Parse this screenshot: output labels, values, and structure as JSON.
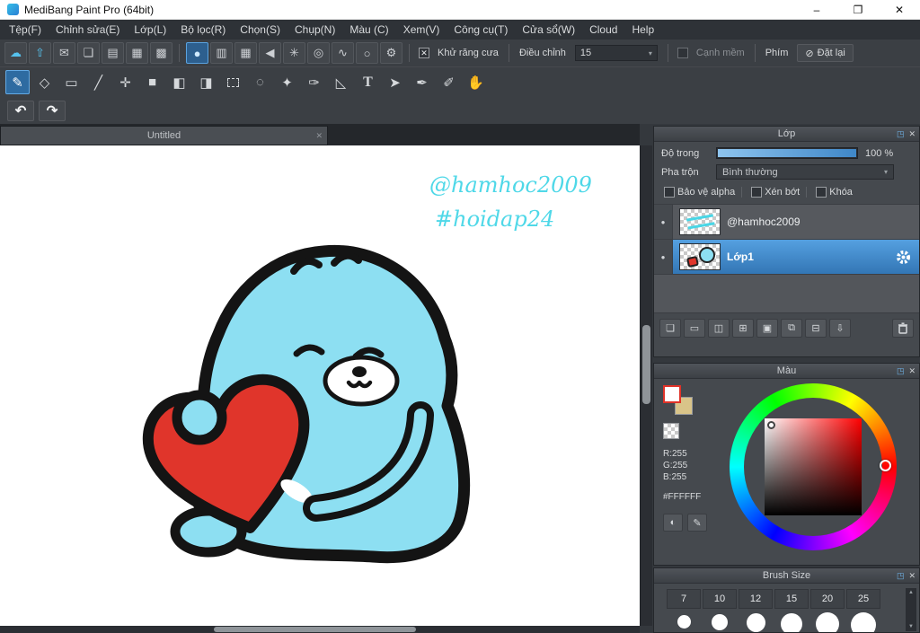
{
  "window": {
    "title": "MediBang Paint Pro (64bit)",
    "minimize": "–",
    "maximize": "❐",
    "close": "✕"
  },
  "menu": {
    "items": [
      "Tệp(F)",
      "Chỉnh sửa(E)",
      "Lớp(L)",
      "Bộ lọc(R)",
      "Chọn(S)",
      "Chụp(N)",
      "Màu (C)",
      "Xem(V)",
      "Công cụ(T)",
      "Cửa sổ(W)",
      "Cloud",
      "Help"
    ]
  },
  "toolbar1": {
    "file_icons": [
      {
        "name": "cloud-brush",
        "glyph": "☁"
      },
      {
        "name": "publish",
        "glyph": "⇧"
      },
      {
        "name": "comment",
        "glyph": "✉"
      },
      {
        "name": "chat",
        "glyph": "❏"
      },
      {
        "name": "document",
        "glyph": "▤"
      },
      {
        "name": "material-grid",
        "glyph": "▦"
      },
      {
        "name": "palette-cells",
        "glyph": "▩"
      }
    ],
    "brush_type_icons": [
      {
        "name": "brush-circle",
        "glyph": "●"
      },
      {
        "name": "brush-gradient",
        "glyph": "▥"
      },
      {
        "name": "brush-grid",
        "glyph": "▦"
      },
      {
        "name": "brush-triangle",
        "glyph": "◀"
      },
      {
        "name": "brush-scatter",
        "glyph": "✳"
      },
      {
        "name": "brush-concentric",
        "glyph": "◎"
      },
      {
        "name": "brush-curve",
        "glyph": "∿"
      },
      {
        "name": "brush-ring",
        "glyph": "○"
      },
      {
        "name": "brush-settings",
        "glyph": "⚙"
      }
    ],
    "antialias_label": "Khử răng cưa",
    "antialias_check": "✕",
    "adjust_label": "Điều chỉnh",
    "adjust_value": "15",
    "caret": "▾",
    "soft_edge_label": "Cạnh mềm",
    "key_label": "Phím",
    "reset_icon": "⊘",
    "reset_label": "Đặt lại"
  },
  "toolbar2": {
    "tools": [
      {
        "name": "brush-tool",
        "glyph": "✎",
        "selected": true
      },
      {
        "name": "eraser-tool",
        "glyph": "◇"
      },
      {
        "name": "shape-brush-tool",
        "glyph": "▭"
      },
      {
        "name": "line-tool",
        "glyph": "╱"
      },
      {
        "name": "move-tool",
        "glyph": "✛"
      },
      {
        "name": "fill-rect-tool",
        "glyph": "■"
      },
      {
        "name": "bucket-tool",
        "glyph": "◧"
      },
      {
        "name": "gradient-tool",
        "glyph": "◨"
      },
      {
        "name": "select-rect-tool",
        "glyph": ""
      },
      {
        "name": "lasso-tool",
        "glyph": "◌"
      },
      {
        "name": "magic-wand-tool",
        "glyph": "✦"
      },
      {
        "name": "select-pen-tool",
        "glyph": "✑"
      },
      {
        "name": "select-eraser-tool",
        "glyph": "◺"
      },
      {
        "name": "text-tool",
        "glyph": "T"
      },
      {
        "name": "operation-tool",
        "glyph": "➤"
      },
      {
        "name": "pen-tool",
        "glyph": "✒"
      },
      {
        "name": "eyedropper-tool",
        "glyph": "✐"
      },
      {
        "name": "hand-tool",
        "glyph": "✋"
      }
    ]
  },
  "history": {
    "undo": "↶",
    "redo": "↷"
  },
  "tab": {
    "title": "Untitled",
    "close": "✕"
  },
  "canvas": {
    "watermark_line1": "@hamhoc2009",
    "watermark_line2": "#hoidap24",
    "watermark_color": "#4fd8e8",
    "character_color": "#8ddff2",
    "heart_color": "#e0352b",
    "outline_color": "#141414"
  },
  "layers_panel": {
    "title": "Lớp",
    "popout": "◳",
    "close": "✕",
    "opacity_label": "Độ trong",
    "opacity_value": "100 %",
    "blend_label": "Pha trộn",
    "blend_value": "Bình thường",
    "caret": "▾",
    "checks": [
      "Bảo vệ alpha",
      "Xén bớt",
      "Khóa"
    ],
    "eye": "●",
    "layers": [
      {
        "name": "@hamhoc2009"
      },
      {
        "name": "Lớp1",
        "selected": true
      }
    ],
    "buttons": [
      {
        "name": "add-layer",
        "glyph": "❏"
      },
      {
        "name": "add-folder",
        "glyph": "▭"
      },
      {
        "name": "duplicate-layer",
        "glyph": "◫"
      },
      {
        "name": "add-layer-menu",
        "glyph": "⊞"
      },
      {
        "name": "folder",
        "glyph": "▣"
      },
      {
        "name": "copy-layer",
        "glyph": "⧉"
      },
      {
        "name": "merge-down",
        "glyph": "⊟"
      },
      {
        "name": "transfer",
        "glyph": "⇩"
      }
    ]
  },
  "color_panel": {
    "title": "Màu",
    "popout": "◳",
    "close": "✕",
    "rgb": [
      "R:255",
      "G:255",
      "B:255"
    ],
    "hex": "#FFFFFF",
    "foreground": "#FFFFFF",
    "background_swatch": "#d9c489",
    "buttons": [
      {
        "name": "palette",
        "glyph": "◐"
      },
      {
        "name": "palette-edit",
        "glyph": "✎"
      }
    ]
  },
  "brush_panel": {
    "title": "Brush Size",
    "popout": "◳",
    "close": "✕",
    "sizes": [
      "7",
      "10",
      "12",
      "15",
      "20",
      "25"
    ],
    "scroll_up": "▲",
    "scroll_down": "▼"
  },
  "colors": {
    "accent_blue": "#3f87c8",
    "selected_layer": "#3d89cf",
    "panel_bg": "#45494e",
    "toolbar_bg": "#3b3f44"
  }
}
